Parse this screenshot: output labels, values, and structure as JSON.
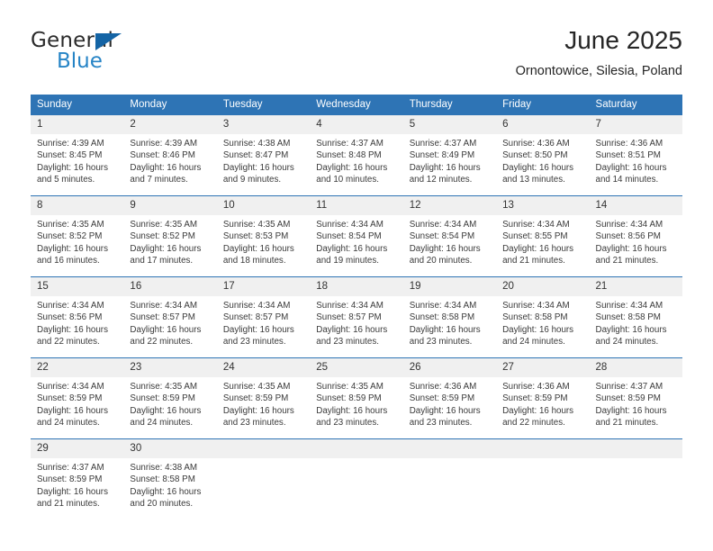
{
  "logo": {
    "word_general": "General",
    "word_blue": "Blue",
    "triangle_color": "#1464a5",
    "blue_text_color": "#2684c6"
  },
  "header": {
    "title": "June 2025",
    "subtitle": "Ornontowice, Silesia, Poland"
  },
  "theme": {
    "header_row_bg": "#2e74b5",
    "cell_top_rule": "#2e74b5",
    "daynum_bg": "#f0f0f0"
  },
  "calendar": {
    "weekday_headers": [
      "Sunday",
      "Monday",
      "Tuesday",
      "Wednesday",
      "Thursday",
      "Friday",
      "Saturday"
    ],
    "weeks": [
      [
        {
          "day": "1",
          "sunrise": "Sunrise: 4:39 AM",
          "sunset": "Sunset: 8:45 PM",
          "daylight_line1": "Daylight: 16 hours",
          "daylight_line2": "and 5 minutes."
        },
        {
          "day": "2",
          "sunrise": "Sunrise: 4:39 AM",
          "sunset": "Sunset: 8:46 PM",
          "daylight_line1": "Daylight: 16 hours",
          "daylight_line2": "and 7 minutes."
        },
        {
          "day": "3",
          "sunrise": "Sunrise: 4:38 AM",
          "sunset": "Sunset: 8:47 PM",
          "daylight_line1": "Daylight: 16 hours",
          "daylight_line2": "and 9 minutes."
        },
        {
          "day": "4",
          "sunrise": "Sunrise: 4:37 AM",
          "sunset": "Sunset: 8:48 PM",
          "daylight_line1": "Daylight: 16 hours",
          "daylight_line2": "and 10 minutes."
        },
        {
          "day": "5",
          "sunrise": "Sunrise: 4:37 AM",
          "sunset": "Sunset: 8:49 PM",
          "daylight_line1": "Daylight: 16 hours",
          "daylight_line2": "and 12 minutes."
        },
        {
          "day": "6",
          "sunrise": "Sunrise: 4:36 AM",
          "sunset": "Sunset: 8:50 PM",
          "daylight_line1": "Daylight: 16 hours",
          "daylight_line2": "and 13 minutes."
        },
        {
          "day": "7",
          "sunrise": "Sunrise: 4:36 AM",
          "sunset": "Sunset: 8:51 PM",
          "daylight_line1": "Daylight: 16 hours",
          "daylight_line2": "and 14 minutes."
        }
      ],
      [
        {
          "day": "8",
          "sunrise": "Sunrise: 4:35 AM",
          "sunset": "Sunset: 8:52 PM",
          "daylight_line1": "Daylight: 16 hours",
          "daylight_line2": "and 16 minutes."
        },
        {
          "day": "9",
          "sunrise": "Sunrise: 4:35 AM",
          "sunset": "Sunset: 8:52 PM",
          "daylight_line1": "Daylight: 16 hours",
          "daylight_line2": "and 17 minutes."
        },
        {
          "day": "10",
          "sunrise": "Sunrise: 4:35 AM",
          "sunset": "Sunset: 8:53 PM",
          "daylight_line1": "Daylight: 16 hours",
          "daylight_line2": "and 18 minutes."
        },
        {
          "day": "11",
          "sunrise": "Sunrise: 4:34 AM",
          "sunset": "Sunset: 8:54 PM",
          "daylight_line1": "Daylight: 16 hours",
          "daylight_line2": "and 19 minutes."
        },
        {
          "day": "12",
          "sunrise": "Sunrise: 4:34 AM",
          "sunset": "Sunset: 8:54 PM",
          "daylight_line1": "Daylight: 16 hours",
          "daylight_line2": "and 20 minutes."
        },
        {
          "day": "13",
          "sunrise": "Sunrise: 4:34 AM",
          "sunset": "Sunset: 8:55 PM",
          "daylight_line1": "Daylight: 16 hours",
          "daylight_line2": "and 21 minutes."
        },
        {
          "day": "14",
          "sunrise": "Sunrise: 4:34 AM",
          "sunset": "Sunset: 8:56 PM",
          "daylight_line1": "Daylight: 16 hours",
          "daylight_line2": "and 21 minutes."
        }
      ],
      [
        {
          "day": "15",
          "sunrise": "Sunrise: 4:34 AM",
          "sunset": "Sunset: 8:56 PM",
          "daylight_line1": "Daylight: 16 hours",
          "daylight_line2": "and 22 minutes."
        },
        {
          "day": "16",
          "sunrise": "Sunrise: 4:34 AM",
          "sunset": "Sunset: 8:57 PM",
          "daylight_line1": "Daylight: 16 hours",
          "daylight_line2": "and 22 minutes."
        },
        {
          "day": "17",
          "sunrise": "Sunrise: 4:34 AM",
          "sunset": "Sunset: 8:57 PM",
          "daylight_line1": "Daylight: 16 hours",
          "daylight_line2": "and 23 minutes."
        },
        {
          "day": "18",
          "sunrise": "Sunrise: 4:34 AM",
          "sunset": "Sunset: 8:57 PM",
          "daylight_line1": "Daylight: 16 hours",
          "daylight_line2": "and 23 minutes."
        },
        {
          "day": "19",
          "sunrise": "Sunrise: 4:34 AM",
          "sunset": "Sunset: 8:58 PM",
          "daylight_line1": "Daylight: 16 hours",
          "daylight_line2": "and 23 minutes."
        },
        {
          "day": "20",
          "sunrise": "Sunrise: 4:34 AM",
          "sunset": "Sunset: 8:58 PM",
          "daylight_line1": "Daylight: 16 hours",
          "daylight_line2": "and 24 minutes."
        },
        {
          "day": "21",
          "sunrise": "Sunrise: 4:34 AM",
          "sunset": "Sunset: 8:58 PM",
          "daylight_line1": "Daylight: 16 hours",
          "daylight_line2": "and 24 minutes."
        }
      ],
      [
        {
          "day": "22",
          "sunrise": "Sunrise: 4:34 AM",
          "sunset": "Sunset: 8:59 PM",
          "daylight_line1": "Daylight: 16 hours",
          "daylight_line2": "and 24 minutes."
        },
        {
          "day": "23",
          "sunrise": "Sunrise: 4:35 AM",
          "sunset": "Sunset: 8:59 PM",
          "daylight_line1": "Daylight: 16 hours",
          "daylight_line2": "and 24 minutes."
        },
        {
          "day": "24",
          "sunrise": "Sunrise: 4:35 AM",
          "sunset": "Sunset: 8:59 PM",
          "daylight_line1": "Daylight: 16 hours",
          "daylight_line2": "and 23 minutes."
        },
        {
          "day": "25",
          "sunrise": "Sunrise: 4:35 AM",
          "sunset": "Sunset: 8:59 PM",
          "daylight_line1": "Daylight: 16 hours",
          "daylight_line2": "and 23 minutes."
        },
        {
          "day": "26",
          "sunrise": "Sunrise: 4:36 AM",
          "sunset": "Sunset: 8:59 PM",
          "daylight_line1": "Daylight: 16 hours",
          "daylight_line2": "and 23 minutes."
        },
        {
          "day": "27",
          "sunrise": "Sunrise: 4:36 AM",
          "sunset": "Sunset: 8:59 PM",
          "daylight_line1": "Daylight: 16 hours",
          "daylight_line2": "and 22 minutes."
        },
        {
          "day": "28",
          "sunrise": "Sunrise: 4:37 AM",
          "sunset": "Sunset: 8:59 PM",
          "daylight_line1": "Daylight: 16 hours",
          "daylight_line2": "and 21 minutes."
        }
      ],
      [
        {
          "day": "29",
          "sunrise": "Sunrise: 4:37 AM",
          "sunset": "Sunset: 8:59 PM",
          "daylight_line1": "Daylight: 16 hours",
          "daylight_line2": "and 21 minutes."
        },
        {
          "day": "30",
          "sunrise": "Sunrise: 4:38 AM",
          "sunset": "Sunset: 8:58 PM",
          "daylight_line1": "Daylight: 16 hours",
          "daylight_line2": "and 20 minutes."
        },
        {
          "day": "",
          "sunrise": "",
          "sunset": "",
          "daylight_line1": "",
          "daylight_line2": ""
        },
        {
          "day": "",
          "sunrise": "",
          "sunset": "",
          "daylight_line1": "",
          "daylight_line2": ""
        },
        {
          "day": "",
          "sunrise": "",
          "sunset": "",
          "daylight_line1": "",
          "daylight_line2": ""
        },
        {
          "day": "",
          "sunrise": "",
          "sunset": "",
          "daylight_line1": "",
          "daylight_line2": ""
        },
        {
          "day": "",
          "sunrise": "",
          "sunset": "",
          "daylight_line1": "",
          "daylight_line2": ""
        }
      ]
    ]
  }
}
